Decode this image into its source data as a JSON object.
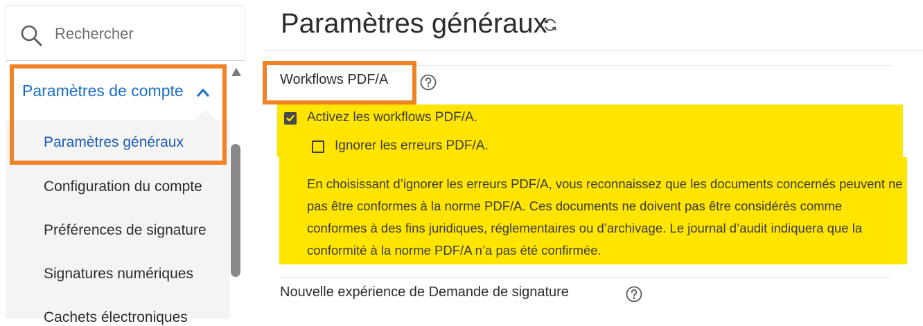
{
  "colors": {
    "accent_blue": "#1a6ec7",
    "active_blue": "#1a5bb5",
    "highlight_orange": "#f08326",
    "highlight_yellow": "#ffe500",
    "nav_background": "#f4f4f4"
  },
  "search": {
    "placeholder": "Rechercher",
    "icon": "search-icon"
  },
  "sidebar": {
    "section_label": "Paramètres de compte",
    "section_icon": "chevron-up-icon",
    "items": [
      {
        "label": "Paramètres généraux",
        "active": true
      },
      {
        "label": "Configuration du compte",
        "active": false
      },
      {
        "label": "Préférences de signature",
        "active": false
      },
      {
        "label": "Signatures numériques",
        "active": false
      },
      {
        "label": "Cachets électroniques",
        "active": false
      }
    ]
  },
  "main": {
    "title": "Paramètres généraux",
    "title_icon": "refresh-icon",
    "sections": [
      {
        "title": "Workflows PDF/A",
        "help_icon": "help-icon",
        "options": [
          {
            "label": "Activez les workflows PDF/A.",
            "checked": true
          },
          {
            "label": "Ignorer les erreurs PDF/A.",
            "checked": false
          }
        ],
        "description": "En choisissant d’ignorer les erreurs PDF/A, vous reconnaissez que les documents concernés peuvent ne pas être conformes à la norme PDF/A. Ces documents ne doivent pas être considérés comme conformes à des fins juridiques, réglementaires ou d’archivage. Le journal d’audit indiquera que la conformité à la norme PDF/A n’a pas été confirmée."
      },
      {
        "title": "Nouvelle expérience de Demande de signature",
        "help_icon": "help-icon"
      }
    ]
  }
}
